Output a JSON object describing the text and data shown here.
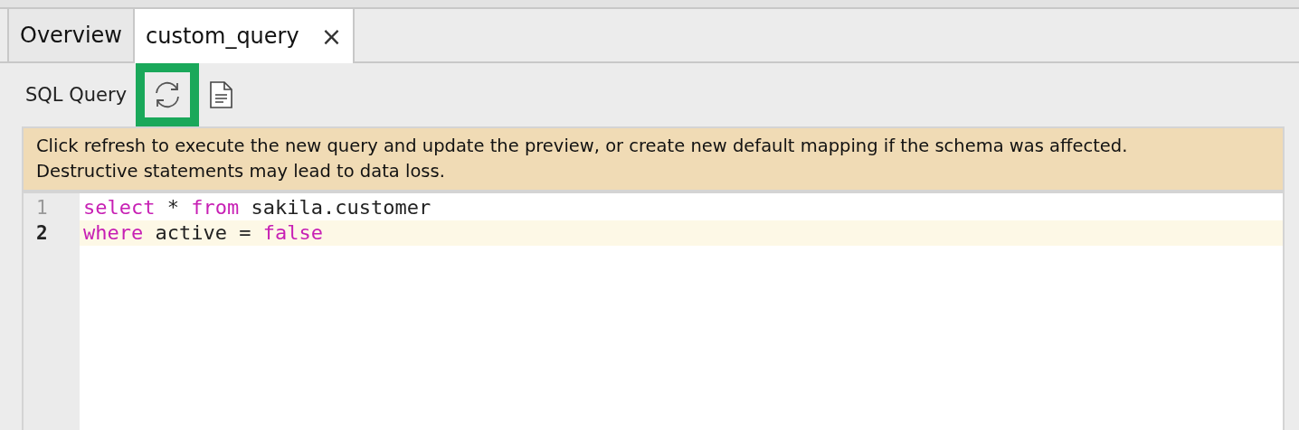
{
  "tabs": [
    {
      "label": "Overview",
      "selected": false
    },
    {
      "label": "custom_query",
      "selected": true,
      "close_icon": "×"
    }
  ],
  "toolbar": {
    "label": "SQL Query",
    "buttons": [
      {
        "kind": "refresh",
        "highlighted": true
      },
      {
        "kind": "document",
        "highlighted": false
      }
    ]
  },
  "notice": "Click refresh to execute the new query and update the preview, or create new default mapping if the schema was affected. Destructive statements may lead to data loss.",
  "editor": {
    "lines": [
      {
        "number": "1",
        "current": false,
        "tokens": [
          {
            "text": "select",
            "kind": "keyword"
          },
          {
            "text": " * ",
            "kind": "plain"
          },
          {
            "text": "from",
            "kind": "keyword"
          },
          {
            "text": " sakila.customer",
            "kind": "plain"
          }
        ]
      },
      {
        "number": "2",
        "current": true,
        "tokens": [
          {
            "text": "where",
            "kind": "keyword"
          },
          {
            "text": " active = ",
            "kind": "plain"
          },
          {
            "text": "false",
            "kind": "keyword"
          }
        ]
      }
    ]
  }
}
